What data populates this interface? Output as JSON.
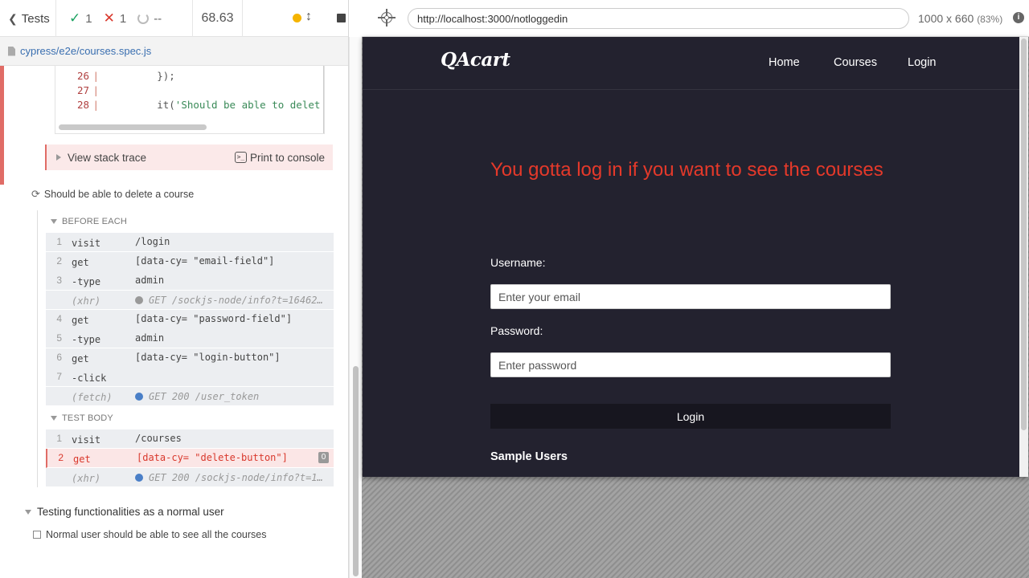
{
  "reporter": {
    "tests_label": "Tests",
    "passed": "1",
    "failed": "1",
    "pending": "--",
    "duration": "68.63",
    "spec_path": "cypress/e2e/courses.spec.js"
  },
  "code_frame": {
    "lines": [
      {
        "num": "26",
        "text": "        });"
      },
      {
        "num": "27",
        "text": ""
      },
      {
        "num": "28",
        "text_pre": "        it(",
        "text_str": "'Should be able to delet"
      }
    ]
  },
  "error_actions": {
    "stack_trace": "View stack trace",
    "print_console": "Print to console"
  },
  "test": {
    "title": "Should be able to delete a course",
    "before_each_label": "BEFORE EACH",
    "before_each": [
      {
        "num": "1",
        "name": "visit",
        "msg": "/login"
      },
      {
        "num": "2",
        "name": "get",
        "msg": "[data-cy= \"email-field\"]"
      },
      {
        "num": "3",
        "name": "-type",
        "msg": "admin"
      },
      {
        "num": "",
        "name": "(xhr)",
        "msg": "GET /sockjs-node/info?t=16462…"
      },
      {
        "num": "4",
        "name": "get",
        "msg": "[data-cy= \"password-field\"]"
      },
      {
        "num": "5",
        "name": "-type",
        "msg": "admin"
      },
      {
        "num": "6",
        "name": "get",
        "msg": "[data-cy= \"login-button\"]"
      },
      {
        "num": "7",
        "name": "-click",
        "msg": ""
      },
      {
        "num": "",
        "name": "(fetch)",
        "msg": "GET 200 /user_token"
      }
    ],
    "test_body_label": "TEST BODY",
    "test_body": [
      {
        "num": "1",
        "name": "visit",
        "msg": "/courses"
      },
      {
        "num": "2",
        "name": "get",
        "msg": "[data-cy= \"delete-button\"]",
        "count": "0"
      },
      {
        "num": "",
        "name": "(xhr)",
        "msg": "GET 200 /sockjs-node/info?t=1…"
      }
    ]
  },
  "suite_normal": {
    "title": "Testing functionalities as a normal user",
    "test": "Normal user should be able to see all the courses"
  },
  "aut": {
    "url": "http://localhost:3000/notloggedin",
    "viewport": "1000 x 660",
    "scale": "(83%)"
  },
  "app": {
    "logo": "QAcart",
    "nav": [
      "Home",
      "Courses",
      "Login"
    ],
    "warning": "You gotta log in if you want to see the courses",
    "username_label": "Username:",
    "username_placeholder": "Enter your email",
    "password_label": "Password:",
    "password_placeholder": "Enter password",
    "login_button": "Login",
    "sample_users": "Sample Users"
  },
  "colors": {
    "pass": "#1aa260",
    "fail": "#d9382c",
    "app_bg": "#23222f",
    "warning": "#e5392a"
  }
}
